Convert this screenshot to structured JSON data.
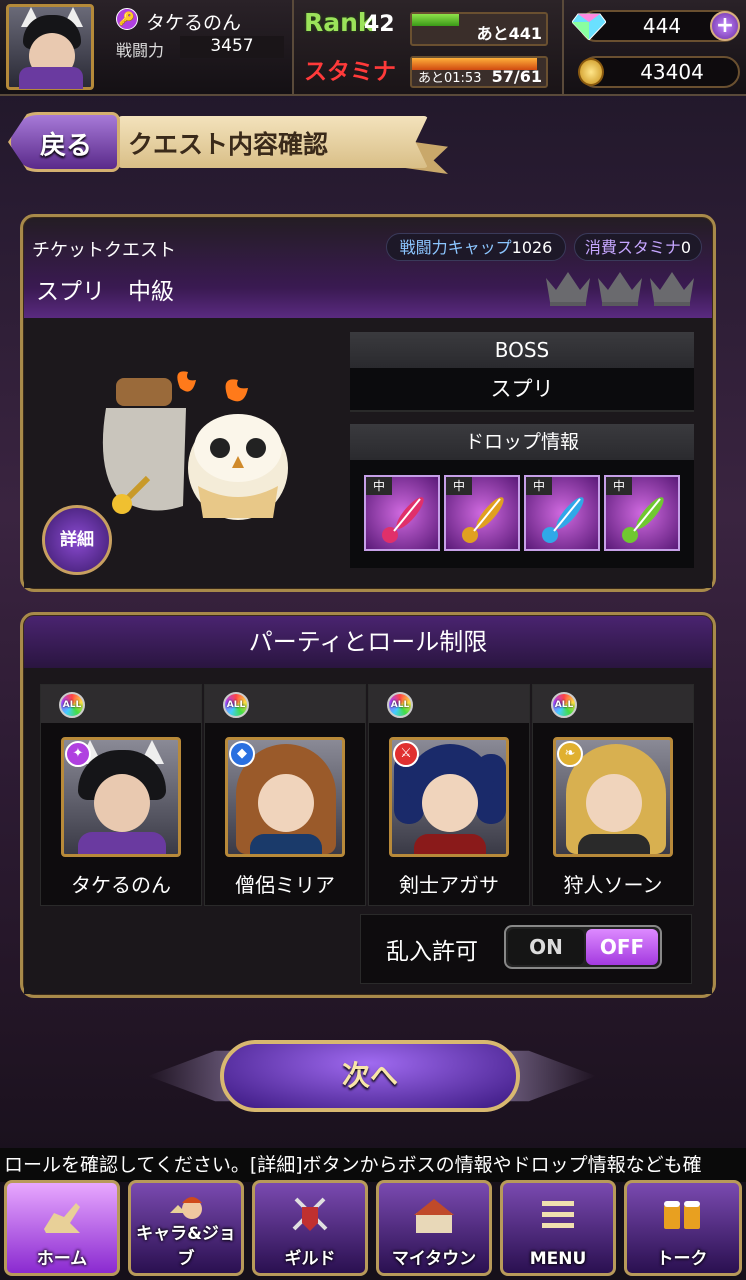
{
  "player": {
    "name": "タケるのん",
    "power_label": "戦闘力",
    "power": "3457"
  },
  "rank": {
    "label": "Rank",
    "value": "42",
    "exp_remaining": "あと441",
    "exp_fraction": 0.35
  },
  "stamina": {
    "label": "スタミナ",
    "recover_time": "あと01:53",
    "value": "57/61",
    "fraction": 0.93
  },
  "currency": {
    "gems": "444",
    "gold": "43404"
  },
  "header": {
    "back_label": "戻る",
    "title": "クエスト内容確認"
  },
  "quest": {
    "type": "チケットクエスト",
    "name": "スプリ　中級",
    "power_cap_label": "戦闘力キャップ",
    "power_cap": "1026",
    "stamina_cost_label": "消費スタミナ",
    "stamina_cost": "0",
    "difficulty_crowns": 3,
    "boss_header": "BOSS",
    "boss_name": "スプリ",
    "drop_header": "ドロップ情報",
    "drops": [
      {
        "tag": "中",
        "color": "#e0306a"
      },
      {
        "tag": "中",
        "color": "#e0a020"
      },
      {
        "tag": "中",
        "color": "#30a8e8"
      },
      {
        "tag": "中",
        "color": "#70c830"
      }
    ],
    "detail_label": "詳細"
  },
  "party": {
    "header": "パーティとロール制限",
    "all_label": "ALL",
    "members": [
      {
        "name": "タケるのん",
        "role_icon": "staff-icon",
        "role_color": "#b040e0",
        "hair": "#151518"
      },
      {
        "name": "僧侶ミリア",
        "role_icon": "shield-icon",
        "role_color": "#2a70e0",
        "hair": "#9a5a2a"
      },
      {
        "name": "剣士アガサ",
        "role_icon": "sword-icon",
        "role_color": "#e03030",
        "hair": "#1a2a6a"
      },
      {
        "name": "狩人ソーン",
        "role_icon": "wing-icon",
        "role_color": "#e0b030",
        "hair": "#d8b050"
      }
    ],
    "intrusion_label": "乱入許可",
    "on_label": "ON",
    "off_label": "OFF"
  },
  "next_label": "次へ",
  "ticker": "ロールを確認してください。[詳細]ボタンからボスの情報やドロップ情報なども確",
  "nav": [
    {
      "label": "ホーム",
      "icon": "home-rider-icon"
    },
    {
      "label": "キャラ&ジョブ",
      "icon": "character-icon"
    },
    {
      "label": "ギルド",
      "icon": "guild-crossed-swords-icon"
    },
    {
      "label": "マイタウン",
      "icon": "town-icon"
    },
    {
      "label": "MENU",
      "icon": "menu-icon"
    },
    {
      "label": "トーク",
      "icon": "beer-mug-icon"
    }
  ]
}
